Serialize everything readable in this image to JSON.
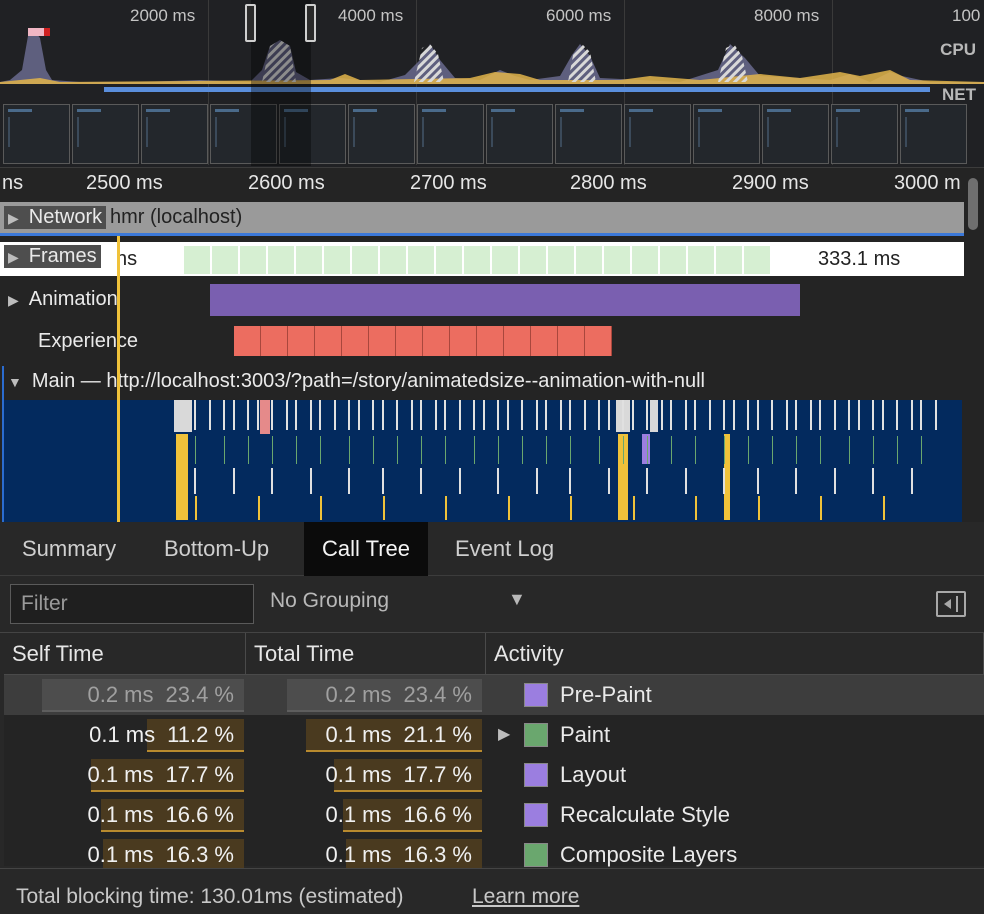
{
  "overview": {
    "ticks": [
      "2000 ms",
      "4000 ms",
      "6000 ms",
      "8000 ms",
      "100"
    ],
    "cpu_label": "CPU",
    "net_label": "NET"
  },
  "ruler": {
    "ticks": [
      "ns",
      "2500 ms",
      "2600 ms",
      "2700 ms",
      "2800 ms",
      "2900 ms",
      "3000 m"
    ]
  },
  "tracks": {
    "network": {
      "label": "Network",
      "bar_text": "hmr (localhost)"
    },
    "frames": {
      "label": "Frames",
      "partial_text": "ns",
      "duration": "333.1 ms"
    },
    "animation": {
      "label": "Animation"
    },
    "experience": {
      "label": "Experience"
    },
    "main": {
      "label": "Main — http://localhost:3003/?path=/story/animatedsize--animation-with-null"
    }
  },
  "tabs": {
    "summary": "Summary",
    "bottom_up": "Bottom-Up",
    "call_tree": "Call Tree",
    "event_log": "Event Log",
    "active": "Call Tree"
  },
  "filter": {
    "placeholder": "Filter",
    "grouping": "No Grouping"
  },
  "table": {
    "headers": {
      "self": "Self Time",
      "total": "Total Time",
      "activity": "Activity"
    },
    "rows": [
      {
        "self_time": "0.2 ms",
        "self_pct": "23.4 %",
        "total_time": "0.2 ms",
        "total_pct": "23.4 %",
        "activity": "Pre-Paint",
        "color": "#9b7ee0",
        "expandable": false,
        "self_fraction": 0.234,
        "total_fraction": 0.234
      },
      {
        "self_time": "0.1 ms",
        "self_pct": "11.2 %",
        "total_time": "0.1 ms",
        "total_pct": "21.1 %",
        "activity": "Paint",
        "color": "#6aa76e",
        "expandable": true,
        "self_fraction": 0.112,
        "total_fraction": 0.211
      },
      {
        "self_time": "0.1 ms",
        "self_pct": "17.7 %",
        "total_time": "0.1 ms",
        "total_pct": "17.7 %",
        "activity": "Layout",
        "color": "#9b7ee0",
        "expandable": false,
        "self_fraction": 0.177,
        "total_fraction": 0.177
      },
      {
        "self_time": "0.1 ms",
        "self_pct": "16.6 %",
        "total_time": "0.1 ms",
        "total_pct": "16.6 %",
        "activity": "Recalculate Style",
        "color": "#9b7ee0",
        "expandable": false,
        "self_fraction": 0.166,
        "total_fraction": 0.166
      },
      {
        "self_time": "0.1 ms",
        "self_pct": "16.3 %",
        "total_time": "0.1 ms",
        "total_pct": "16.3 %",
        "activity": "Composite Layers",
        "color": "#6aa76e",
        "expandable": false,
        "self_fraction": 0.163,
        "total_fraction": 0.163
      }
    ]
  },
  "status": {
    "text": "Total blocking time: 130.01ms (estimated)",
    "link": "Learn more"
  },
  "colors": {
    "accent_cursor": "#f0c23a",
    "animation_bar": "#7a5fb0",
    "experience_bar": "#ec6d60",
    "frames_bar": "#d6efd2",
    "main_bg": "#032a5e",
    "net_bar": "#5a8edc"
  }
}
